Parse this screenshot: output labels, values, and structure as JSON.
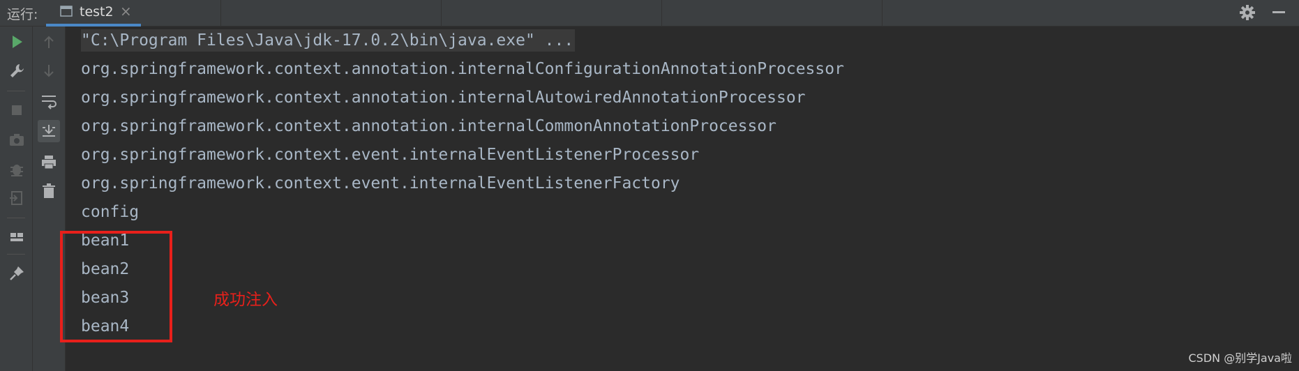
{
  "header": {
    "run_label": "运行:",
    "tab": {
      "label": "test2",
      "close": "×"
    }
  },
  "console": {
    "lines": [
      "\"C:\\Program Files\\Java\\jdk-17.0.2\\bin\\java.exe\" ...",
      "org.springframework.context.annotation.internalConfigurationAnnotationProcessor",
      "org.springframework.context.annotation.internalAutowiredAnnotationProcessor",
      "org.springframework.context.annotation.internalCommonAnnotationProcessor",
      "org.springframework.context.event.internalEventListenerProcessor",
      "org.springframework.context.event.internalEventListenerFactory",
      "config",
      "bean1",
      "bean2",
      "bean3",
      "bean4"
    ]
  },
  "annotation": {
    "text": "成功注入",
    "color": "#e8201b"
  },
  "watermark": "CSDN @别学Java啦",
  "icons": {
    "left_toolbar": [
      "run-icon",
      "wrench-icon",
      "stop-icon",
      "camera-icon",
      "debug-icon",
      "exit-icon",
      "layout-icon",
      "pin-icon"
    ],
    "second_toolbar": [
      "up-arrow-icon",
      "down-arrow-icon",
      "soft-wrap-icon",
      "scroll-to-end-icon",
      "print-icon",
      "trash-icon"
    ],
    "header": [
      "console-tab-icon",
      "gear-icon",
      "minimize-icon"
    ]
  },
  "colors": {
    "background": "#2b2b2b",
    "toolbar": "#3c3f41",
    "text": "#a9b7c6",
    "accent": "#4a88c7",
    "run": "#59a869"
  }
}
